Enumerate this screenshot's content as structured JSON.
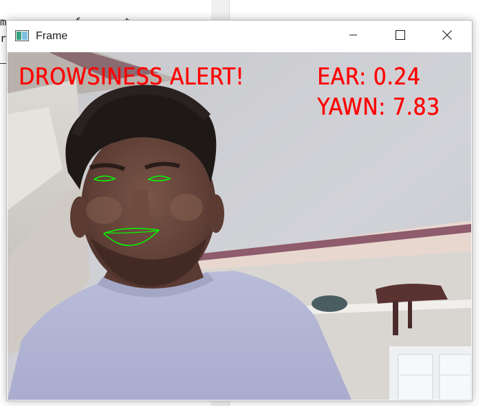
{
  "background_window": {
    "visible_text_lines": [
      "m           f       t  ",
      "r"
    ]
  },
  "window": {
    "title": "Frame",
    "icon": "opencv-frame-icon",
    "controls": {
      "minimize_icon": "minimize-icon",
      "maximize_icon": "maximize-icon",
      "close_icon": "close-icon"
    }
  },
  "video": {
    "alert_text": "DROWSINESS ALERT!",
    "ear_text": "EAR: 0.24",
    "yawn_text": "YAWN: 7.83",
    "overlay_color": "#ff0000",
    "landmark_color": "#00ff00"
  }
}
